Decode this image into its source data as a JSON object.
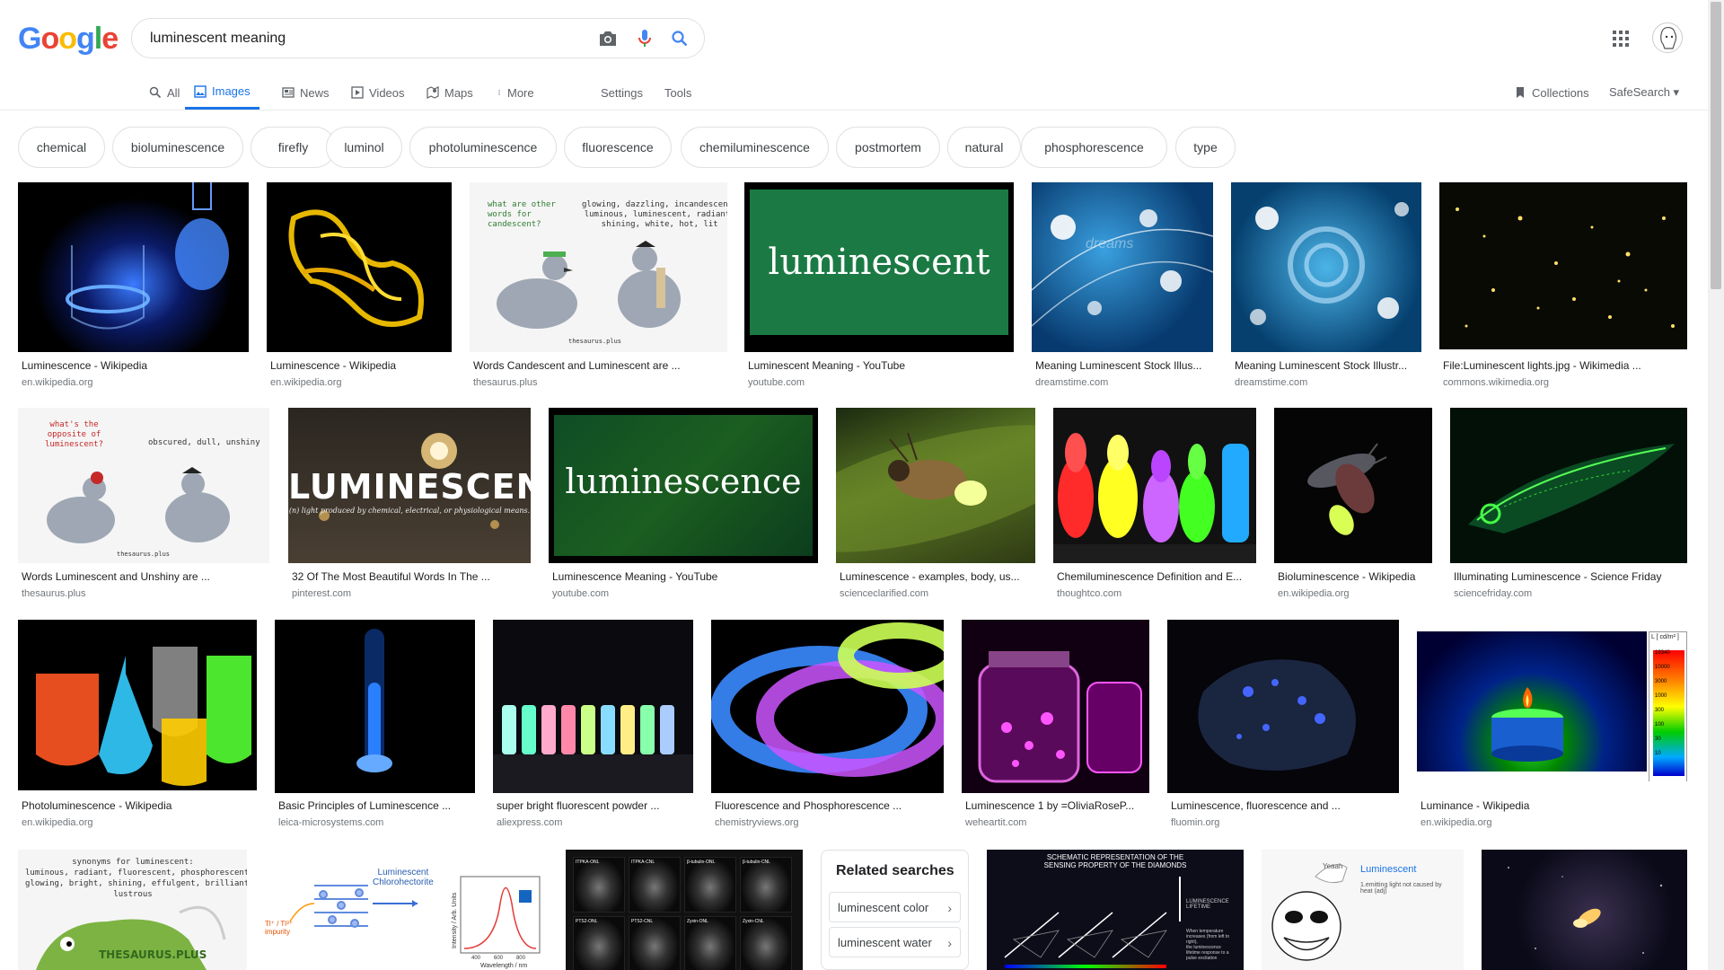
{
  "header": {
    "logo": "Google",
    "search_value": "luminescent meaning",
    "icons": [
      "camera-icon",
      "mic-icon",
      "search-icon",
      "apps-icon",
      "avatar"
    ]
  },
  "tabs": [
    {
      "label": "All",
      "icon": "search-icon"
    },
    {
      "label": "Images",
      "icon": "image-icon",
      "active": true
    },
    {
      "label": "News",
      "icon": "news-icon"
    },
    {
      "label": "Videos",
      "icon": "video-icon"
    },
    {
      "label": "Maps",
      "icon": "map-icon"
    },
    {
      "label": "More",
      "icon": "dots-icon"
    },
    {
      "label": "Settings"
    },
    {
      "label": "Tools"
    },
    {
      "label": "Collections",
      "icon": "bookmark-icon"
    },
    {
      "label": "SafeSearch ▾"
    }
  ],
  "chips": [
    "chemical",
    "bioluminescence",
    "firefly",
    "luminol",
    "photoluminescence",
    "fluorescence",
    "chemiluminescence",
    "postmortem",
    "natural",
    "phosphorescence",
    "type"
  ],
  "results": [
    {
      "title": "Luminescence - Wikipedia",
      "site": "en.wikipedia.org"
    },
    {
      "title": "Luminescence - Wikipedia",
      "site": "en.wikipedia.org"
    },
    {
      "title": "Words Candescent and Luminescent are ...",
      "site": "thesaurus.plus"
    },
    {
      "title": "Luminescent Meaning - YouTube",
      "site": "youtube.com"
    },
    {
      "title": "Meaning Luminescent Stock Illus...",
      "site": "dreamstime.com"
    },
    {
      "title": "Meaning Luminescent Stock Illustr...",
      "site": "dreamstime.com"
    },
    {
      "title": "File:Luminescent lights.jpg - Wikimedia ...",
      "site": "commons.wikimedia.org"
    },
    {
      "title": "Words Luminescent and Unshiny are ...",
      "site": "thesaurus.plus"
    },
    {
      "title": "32 Of The Most Beautiful Words In The ...",
      "site": "pinterest.com"
    },
    {
      "title": "Luminescence Meaning - YouTube",
      "site": "youtube.com"
    },
    {
      "title": "Luminescence - examples, body, us...",
      "site": "scienceclarified.com"
    },
    {
      "title": "Chemiluminescence Definition and E...",
      "site": "thoughtco.com"
    },
    {
      "title": "Bioluminescence - Wikipedia",
      "site": "en.wikipedia.org"
    },
    {
      "title": "Illuminating Luminescence - Science Friday",
      "site": "sciencefriday.com"
    },
    {
      "title": "Photoluminescence - Wikipedia",
      "site": "en.wikipedia.org"
    },
    {
      "title": "Basic Principles of Luminescence ...",
      "site": "leica-microsystems.com"
    },
    {
      "title": "super bright fluorescent powder ...",
      "site": "aliexpress.com"
    },
    {
      "title": "Fluorescence and Phosphorescence ...",
      "site": "chemistryviews.org"
    },
    {
      "title": "Luminescence 1 by =OliviaRoseP...",
      "site": "weheartit.com"
    },
    {
      "title": "Luminescence, fluorescence and ...",
      "site": "fluomin.org"
    },
    {
      "title": "Luminance - Wikipedia",
      "site": "en.wikipedia.org"
    }
  ],
  "thumb_text": {
    "t3_q": "what are other\nwords for\ncandescent?",
    "t3_a": "glowing, dazzling, incandescent,\nluminous, luminescent, radiant,\nshining, white, hot, lit",
    "t3_brand": "thesaurus.plus",
    "t4": "luminescent",
    "t5_wm": "dreams",
    "t8_q": "what's the\nopposite of\nluminescent?",
    "t8_a": "obscured, dull, unshiny",
    "t8_brand": "thesaurus.plus",
    "t9_title": "LUMINESCENCE",
    "t9_def": "(n) light produced by chemical, electrical, or physiological means.",
    "t10": "luminescence",
    "t21_head": "L [ cd/m² ]",
    "t21_scale": [
      "19340",
      "10000",
      "3000",
      "1000",
      "300",
      "100",
      "30",
      "10"
    ],
    "t22": "synonyms for luminescent:\nluminous, radiant, fluorescent, phosphorescent,\nglowing, bright, shining, effulgent, brilliant,\nlustrous",
    "t22_brand": "THESAURUS.PLUS",
    "t23_label": "Luminescent\nChlorohectorite",
    "t23_x": "Wavelength / nm",
    "t23_y": "Intensity / Arb. Units",
    "t23_left": "Tl⁺ / Tl³⁺\nimpurity",
    "t23_ticks": [
      "400",
      "600",
      "800"
    ],
    "t24_labels": [
      "ITPKA-ONL",
      "ITPKA-CNL",
      "β-tubulin-ONL",
      "β-tubulin-CNL",
      "PTS2-ONL",
      "PTS2-CNL",
      "Zyxin-ONL",
      "Zyxin-CNL"
    ],
    "t25_title": "SCHEMATIC REPRESENTATION OF THE\nSENSING PROPERTY OF THE DIAMONDS",
    "t25_label": "LUMINESCENCE\nLIFETIME",
    "t25_note": "When temperature\nincreases (from left to\nright),\nthe luminescence\nlifetime response to a\npulse excitation",
    "t26_bubble": "Yeaah",
    "t26_word": "Luminescent",
    "t26_def": "1.emitting light not caused by\nheat (adj)"
  },
  "related": {
    "title": "Related searches",
    "items": [
      "luminescent color",
      "luminescent water"
    ]
  }
}
